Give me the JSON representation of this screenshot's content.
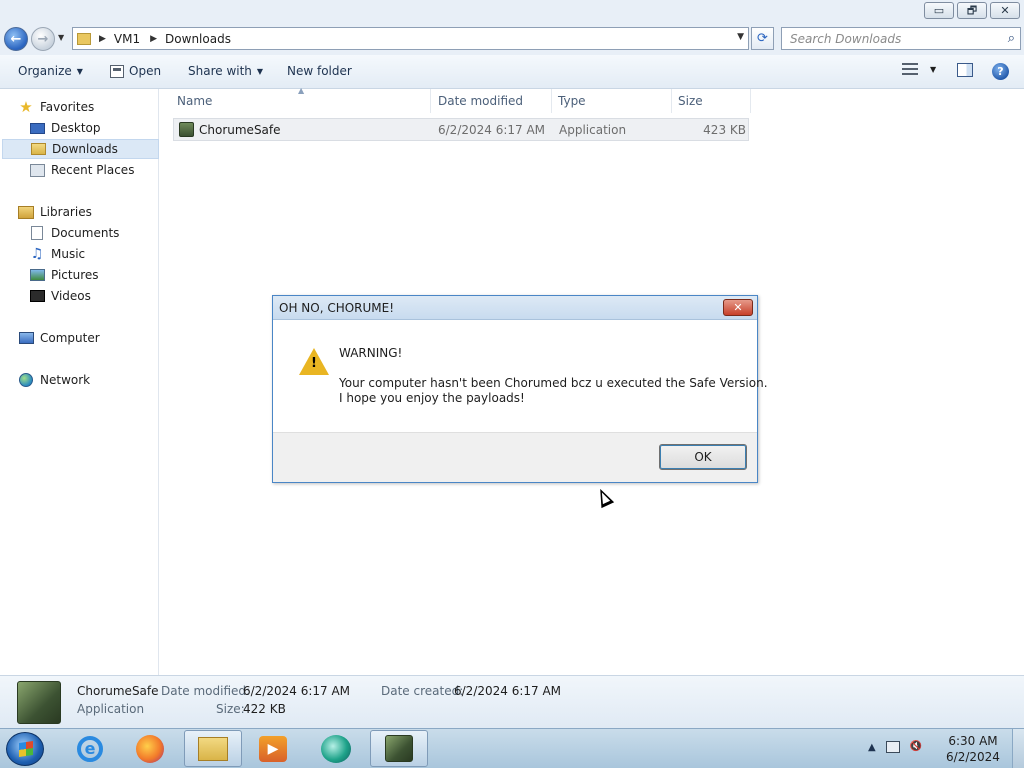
{
  "window": {
    "caption_buttons": {
      "minimize": "▭",
      "restore": "🗗",
      "close": "✕"
    }
  },
  "address": {
    "crumbs": [
      "VM1",
      "Downloads"
    ],
    "search_placeholder": "Search Downloads"
  },
  "toolbar": {
    "organize": "Organize",
    "open": "Open",
    "share_with": "Share with",
    "new_folder": "New folder"
  },
  "nav": {
    "favorites": "Favorites",
    "desktop": "Desktop",
    "downloads": "Downloads",
    "recent_places": "Recent Places",
    "libraries": "Libraries",
    "documents": "Documents",
    "music": "Music",
    "pictures": "Pictures",
    "videos": "Videos",
    "computer": "Computer",
    "network": "Network"
  },
  "columns": {
    "name": "Name",
    "date_modified": "Date modified",
    "type": "Type",
    "size": "Size"
  },
  "files": [
    {
      "name": "ChorumeSafe",
      "date_modified": "6/2/2024 6:17 AM",
      "type": "Application",
      "size": "423 KB"
    }
  ],
  "dialog": {
    "title": "OH NO, CHORUME!",
    "heading": "WARNING!",
    "lines": [
      "Your computer hasn't been Chorumed bcz u executed the Safe Version.",
      "I hope you enjoy the payloads!"
    ],
    "ok": "OK"
  },
  "details": {
    "name": "ChorumeSafe",
    "type": "Application",
    "date_modified_label": "Date modified:",
    "date_modified": "6/2/2024 6:17 AM",
    "date_created_label": "Date created:",
    "date_created": "6/2/2024 6:17 AM",
    "size_label": "Size:",
    "size": "422 KB"
  },
  "taskbar": {
    "apps": [
      "internet-explorer",
      "firefox",
      "windows-explorer",
      "media-center",
      "windows-media-player",
      "chorumesafe"
    ],
    "active_app": "windows-explorer",
    "clock_time": "6:30 AM",
    "clock_date": "6/2/2024"
  },
  "colors": {
    "selection": "#dbe8f6",
    "dialog_border": "#4a86c6",
    "close_red": "#c7402a",
    "warning": "#e9b522"
  }
}
